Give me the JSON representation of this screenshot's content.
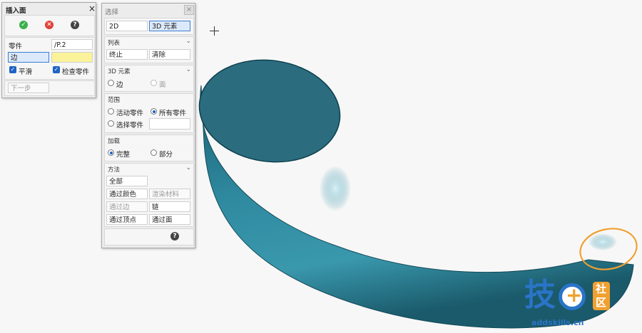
{
  "insert_face": {
    "title": "插入面",
    "close": "×",
    "ok_icon": "check-circle-icon",
    "cancel_icon": "x-circle-icon",
    "help_icon": "question-circle-icon",
    "part_label": "零件",
    "part_value": "/P.2",
    "edge_label": "边",
    "smooth_label": "平滑",
    "check_part_label": "检查零件",
    "next_step": "下一步"
  },
  "select_panel": {
    "title": "选择",
    "mode_2d": "2D",
    "mode_3d": "3D 元素",
    "list_section": "列表",
    "stop": "终止",
    "clear": "清除",
    "elem3d_section": "3D 元素",
    "edge": "边",
    "face": "面",
    "range_section": "范围",
    "active_part": "活动零件",
    "all_parts": "所有零件",
    "select_part": "选择零件",
    "load_section": "加载",
    "complete": "完整",
    "partial": "部分",
    "method_section": "方法",
    "all": "全部",
    "by_color": "通过颜色",
    "render_material": "渲染材料",
    "by_edge": "通过边",
    "chain": "链",
    "by_vertex": "通过顶点",
    "by_face": "通过面"
  },
  "watermark": {
    "brand_char": "技",
    "plus": "+",
    "community_top": "社",
    "community_bottom": "区",
    "domain": "addskills.cn"
  },
  "colors": {
    "tube": "#2a7b90",
    "selection_highlight": "#f0a030",
    "accent_blue": "#1e63c5",
    "yellow_field": "#fbf39a"
  }
}
